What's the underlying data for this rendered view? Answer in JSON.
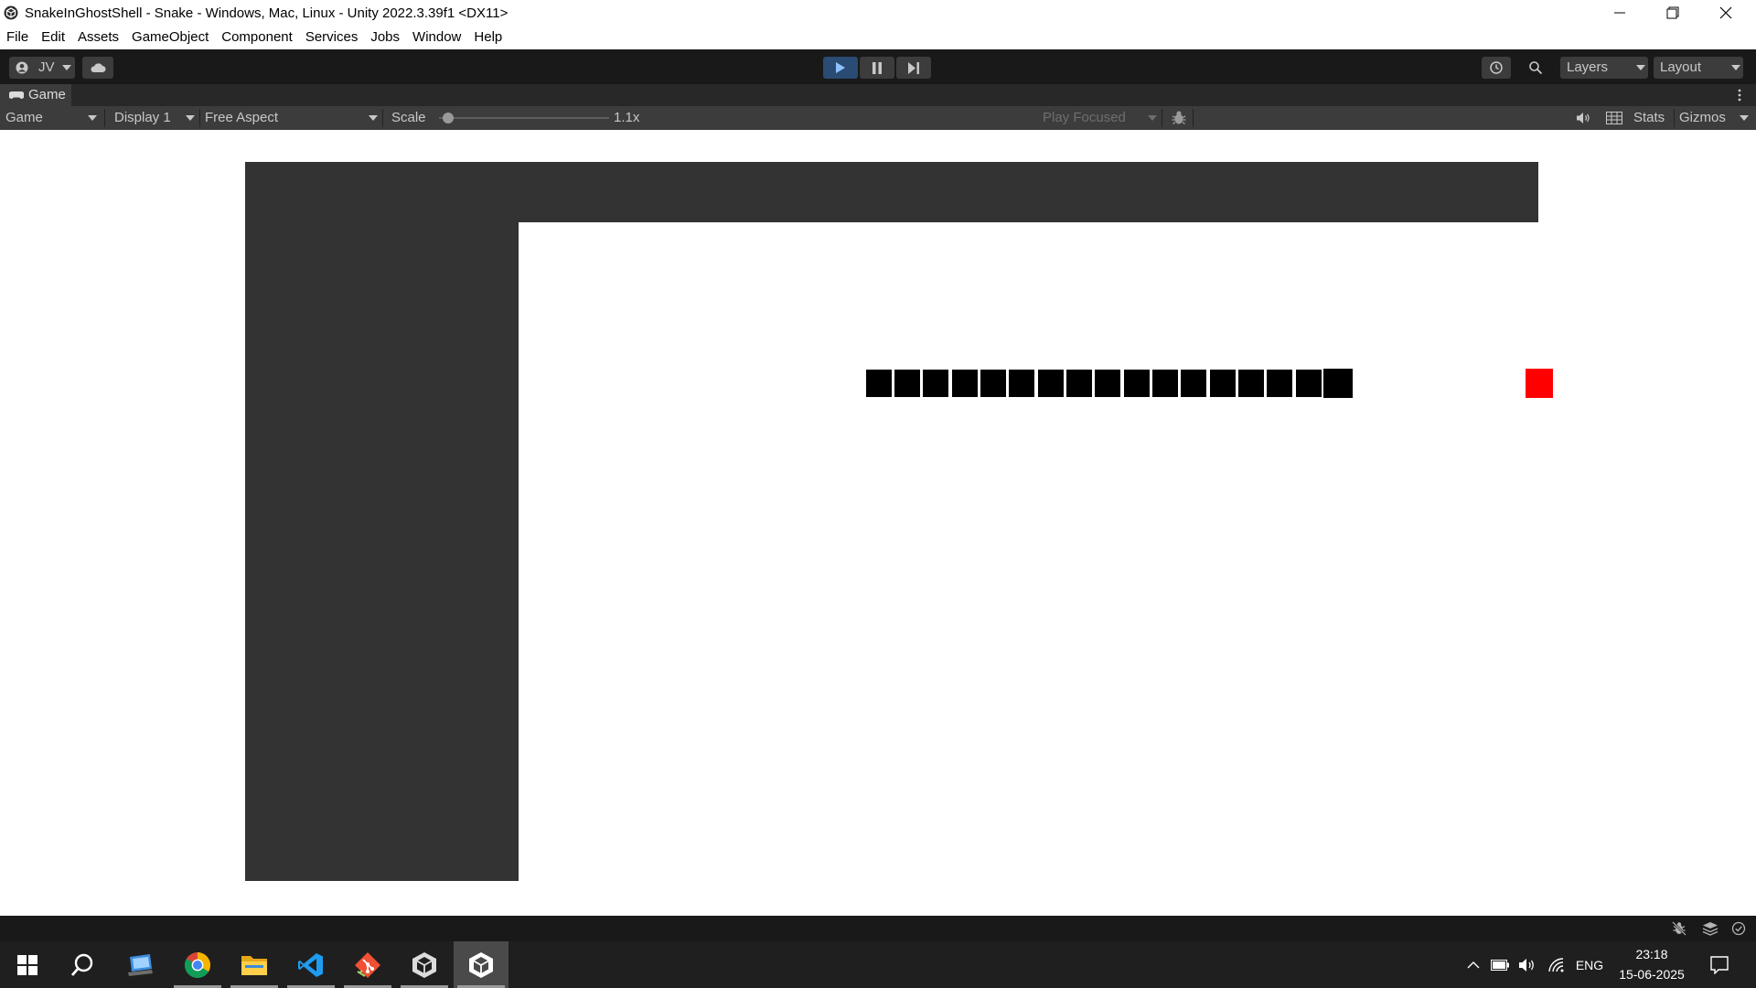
{
  "window": {
    "title": "SnakeInGhostShell - Snake - Windows, Mac, Linux - Unity 2022.3.39f1 <DX11>",
    "controls": [
      "minimize-icon",
      "restore-icon",
      "close-icon"
    ]
  },
  "menu": [
    "File",
    "Edit",
    "Assets",
    "GameObject",
    "Component",
    "Services",
    "Jobs",
    "Window",
    "Help"
  ],
  "toolbar": {
    "account_label": "JV",
    "layers_label": "Layers",
    "layout_label": "Layout",
    "play_active": true,
    "accent_color": "#2a4b73"
  },
  "tab": {
    "label": "Game"
  },
  "game_view": {
    "mode": "Game",
    "display": "Display 1",
    "aspect": "Free Aspect",
    "scale_label": "Scale",
    "scale_value": "1.1x",
    "play_focus": "Play Focused",
    "stats_label": "Stats",
    "gizmos_label": "Gizmos"
  },
  "game": {
    "snake_length": 17,
    "snake_color": "#000000",
    "food_color": "#ff0000",
    "border_color": "#333333"
  },
  "taskbar": {
    "apps": [
      "start-icon",
      "search-icon",
      "desktop-app-icon",
      "chrome-icon",
      "file-explorer-icon",
      "vscode-icon",
      "git-icon",
      "unity-hub-icon",
      "unity-editor-icon"
    ],
    "language": "ENG",
    "time": "23:18",
    "date": "15-06-2025"
  }
}
